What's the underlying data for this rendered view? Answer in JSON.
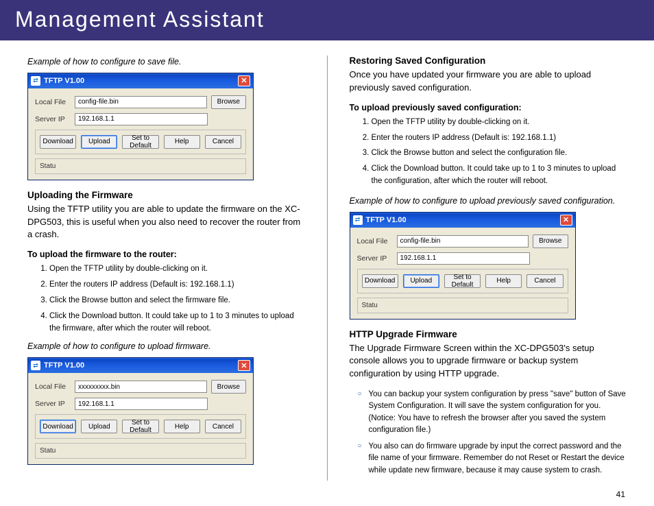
{
  "header": {
    "title": "Management Assistant"
  },
  "page_number": "41",
  "tftp": {
    "window_title": "TFTP V1.00",
    "local_file_label": "Local File",
    "server_ip_label": "Server IP",
    "server_ip_value": "192.168.1.1",
    "config_file_value": "config-file.bin",
    "firmware_file_value": "xxxxxxxxx.bin",
    "browse": "Browse",
    "download": "Download",
    "upload": "Upload",
    "set_default": "Set to Default",
    "help": "Help",
    "cancel": "Cancel",
    "status": "Statu"
  },
  "left": {
    "caption1": "Example of how to configure to save file.",
    "uploading_title": "Uploading the Firmware",
    "uploading_body": "Using the TFTP utility you are able to update the firmware on the XC-DPG503, this is useful when you also need to recover the router from a crash.",
    "fw_sub": "To upload the firmware to the router:",
    "fw_steps": [
      "Open the TFTP utility by double-clicking on it.",
      "Enter the routers IP address (Default is: 192.168.1.1)",
      "Click the Browse button and select the firmware file.",
      "Click the Download button. It could take up to 1 to 3 minutes to upload the firmware, after which the router will reboot."
    ],
    "caption2": "Example of how to configure to upload firmware."
  },
  "right": {
    "restore_title": "Restoring Saved Configuration",
    "restore_body": "Once you have updated your firmware you are able to upload previously saved configuration.",
    "cfg_sub": "To upload previously saved configuration:",
    "cfg_steps": [
      "Open the TFTP utility by double-clicking on it.",
      "Enter the routers IP address (Default is: 192.168.1.1)",
      "Click the Browse button and select the configuration file.",
      "Click the Download button. It could take up to 1 to 3 minutes to upload the configuration, after which the router will reboot."
    ],
    "caption3": "Example of how to configure to upload previously saved configuration.",
    "http_title": "HTTP Upgrade Firmware",
    "http_body": "The Upgrade Firmware Screen within the XC-DPG503's setup console allows you to upgrade firmware or backup system configuration by using HTTP upgrade.",
    "http_bullets": [
      "You can backup your system configuration by press \"save\" button of Save System Configuration. It will save the system configuration for you. (Notice: You have to refresh the browser after you saved the system configuration file.)",
      "You also can do firmware upgrade by input the correct password and the file name of your firmware. Remember do not Reset or Restart the device while update new firmware, because  it may cause system to crash."
    ]
  }
}
